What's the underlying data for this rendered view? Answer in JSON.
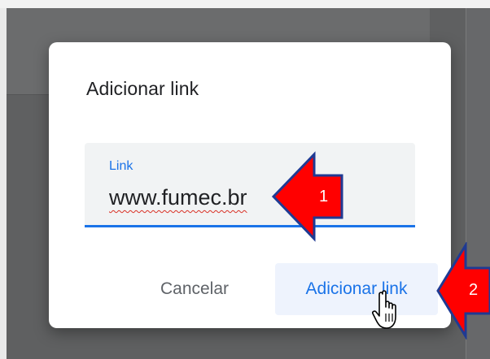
{
  "dialog": {
    "title": "Adicionar link",
    "field_label": "Link",
    "field_value": "www.fumec.br",
    "cancel_label": "Cancelar",
    "submit_label": "Adicionar link"
  },
  "callouts": [
    {
      "number": "1"
    },
    {
      "number": "2"
    }
  ],
  "colors": {
    "accent": "#1a73e8",
    "callout_red": "#ff0000",
    "callout_outline": "#1f3a93",
    "backdrop": "#5f6061"
  },
  "icons": {
    "cursor": "hand-pointer-icon"
  }
}
